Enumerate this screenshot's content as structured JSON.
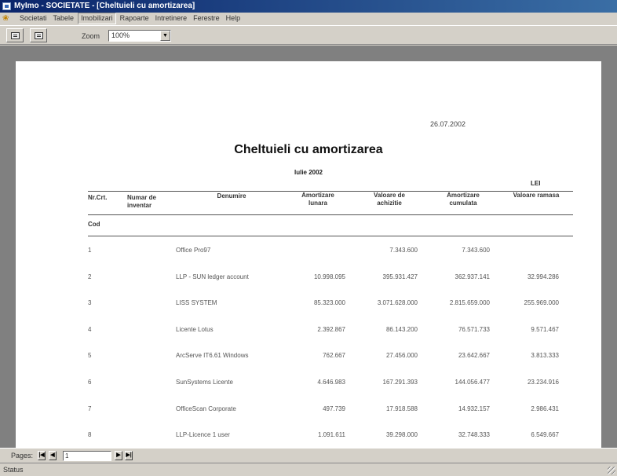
{
  "window": {
    "title": "MyImo - SOCIETATE - [Cheltuieli cu amortizarea]"
  },
  "menu": {
    "items": [
      "Societati",
      "Tabele",
      "Imobilizari",
      "Rapoarte",
      "Intretinere",
      "Ferestre",
      "Help"
    ],
    "active_index": 2
  },
  "toolbar": {
    "print_icon": "printer-icon",
    "export_icon": "export-icon",
    "zoom_label": "Zoom",
    "zoom_value": "100%"
  },
  "report": {
    "date": "26.07.2002",
    "title": "Cheltuieli cu amortizarea",
    "period": "Iulie 2002",
    "currency": "LEI",
    "headers": {
      "nr_crt": "Nr.Crt.",
      "inventar_1": "Numar de",
      "inventar_2": "inventar",
      "denumire": "Denumire",
      "amortizare_lunara_1": "Amortizare",
      "amortizare_lunara_2": "lunara",
      "valoare_achizitie_1": "Valoare de",
      "valoare_achizitie_2": "achizitie",
      "amortizare_cumulata_1": "Amortizare",
      "amortizare_cumulata_2": "cumulata",
      "valoare_ramasa": "Valoare ramasa"
    },
    "cod_label": "Cod",
    "rows": [
      {
        "nr": "1",
        "denumire": "Office Pro97",
        "amortizare_lunara": "",
        "valoare_achizitie": "7.343.600",
        "amortizare_cumulata": "7.343.600",
        "valoare_ramasa": ""
      },
      {
        "nr": "2",
        "denumire": "LLP - SUN ledger account",
        "amortizare_lunara": "10.998.095",
        "valoare_achizitie": "395.931.427",
        "amortizare_cumulata": "362.937.141",
        "valoare_ramasa": "32.994.286"
      },
      {
        "nr": "3",
        "denumire": "LISS SYSTEM",
        "amortizare_lunara": "85.323.000",
        "valoare_achizitie": "3.071.628.000",
        "amortizare_cumulata": "2.815.659.000",
        "valoare_ramasa": "255.969.000"
      },
      {
        "nr": "4",
        "denumire": "Licente Lotus",
        "amortizare_lunara": "2.392.867",
        "valoare_achizitie": "86.143.200",
        "amortizare_cumulata": "76.571.733",
        "valoare_ramasa": "9.571.467"
      },
      {
        "nr": "5",
        "denumire": "ArcServe IT6.61 Windows",
        "amortizare_lunara": "762.667",
        "valoare_achizitie": "27.456.000",
        "amortizare_cumulata": "23.642.667",
        "valoare_ramasa": "3.813.333"
      },
      {
        "nr": "6",
        "denumire": "SunSystems Licente",
        "amortizare_lunara": "4.646.983",
        "valoare_achizitie": "167.291.393",
        "amortizare_cumulata": "144.056.477",
        "valoare_ramasa": "23.234.916"
      },
      {
        "nr": "7",
        "denumire": "OfficeScan Corporate",
        "amortizare_lunara": "497.739",
        "valoare_achizitie": "17.918.588",
        "amortizare_cumulata": "14.932.157",
        "valoare_ramasa": "2.986.431"
      },
      {
        "nr": "8",
        "denumire": "LLP-Licence 1 user",
        "amortizare_lunara": "1.091.611",
        "valoare_achizitie": "39.298.000",
        "amortizare_cumulata": "32.748.333",
        "valoare_ramasa": "6.549.667"
      }
    ]
  },
  "pager": {
    "label": "Pages:",
    "current_page": "1"
  },
  "status": {
    "text": "Status"
  }
}
